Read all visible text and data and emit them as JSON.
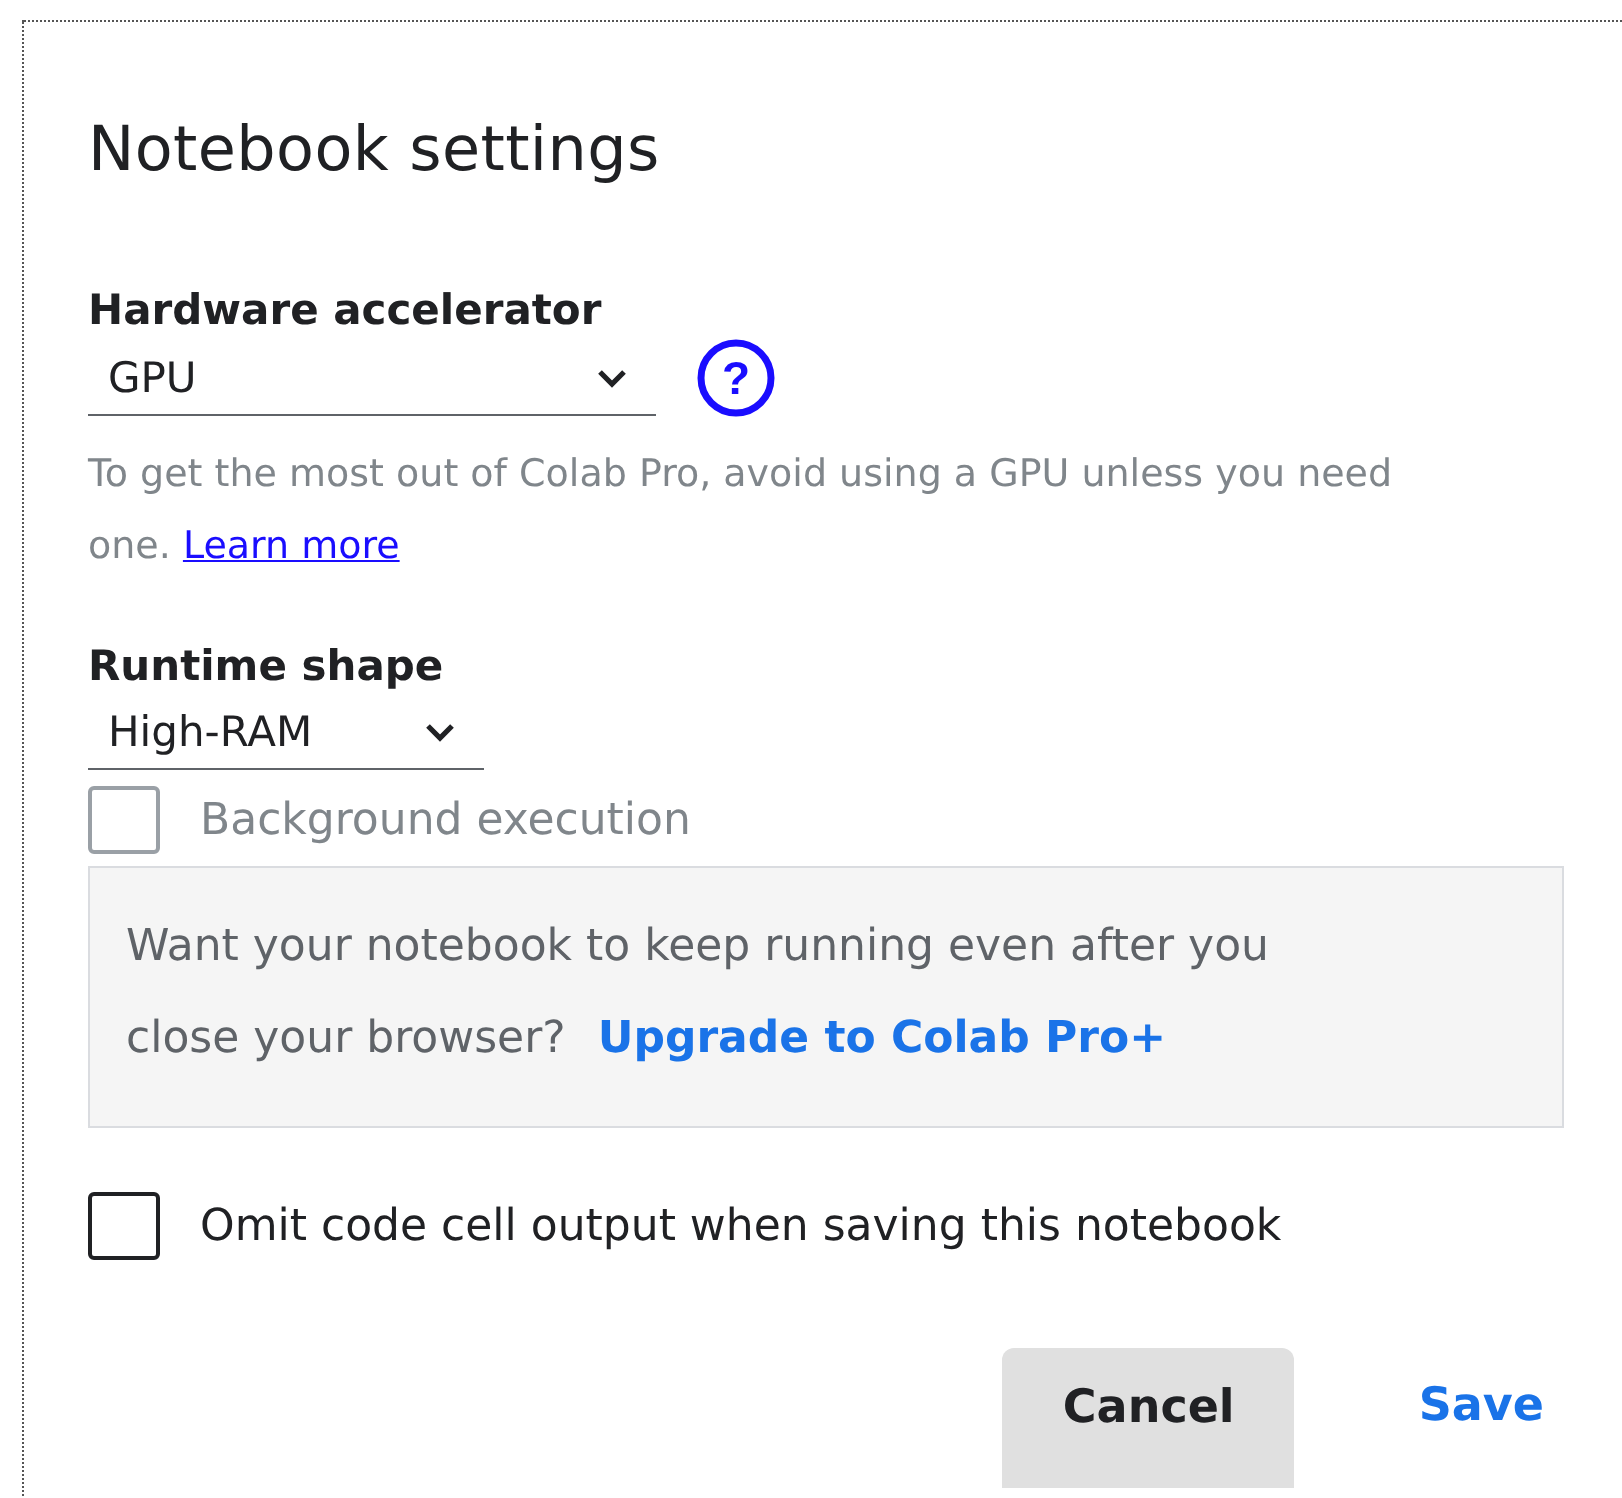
{
  "dialog": {
    "title": "Notebook settings"
  },
  "hardware_accelerator": {
    "label": "Hardware accelerator",
    "value": "GPU",
    "help_glyph": "?",
    "hint": "To get the most out of Colab Pro, avoid using a GPU unless you need one.",
    "hint_link": "Learn more"
  },
  "runtime_shape": {
    "label": "Runtime shape",
    "value": "High-RAM"
  },
  "background_execution": {
    "label": "Background execution",
    "checked": false,
    "disabled": true
  },
  "upgrade_notice": {
    "text": "Want your notebook to keep running even after you close your browser?",
    "link": "Upgrade to Colab Pro+"
  },
  "omit_output": {
    "label": "Omit code cell output when saving this notebook",
    "checked": false,
    "disabled": false
  },
  "buttons": [
    {
      "label": "Cancel",
      "kind": "secondary"
    },
    {
      "label": "Save",
      "kind": "primary"
    }
  ]
}
